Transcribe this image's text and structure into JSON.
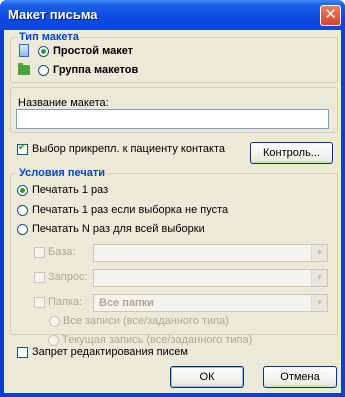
{
  "window": {
    "title": "Макет письма",
    "close_symbol": "✕"
  },
  "template_type": {
    "label": "Тип макета",
    "options": [
      {
        "label": "Простой макет",
        "selected": true
      },
      {
        "label": "Группа макетов",
        "selected": false
      }
    ]
  },
  "template_name": {
    "label": "Название макета:",
    "value": ""
  },
  "attach_contact": {
    "label": "Выбор прикрепл. к пациенту контакта",
    "checked": true
  },
  "control_button": "Контроль...",
  "print_conditions": {
    "label": "Условия печати",
    "options": [
      {
        "label": "Печатать 1 раз",
        "selected": true
      },
      {
        "label": "Печатать 1 раз если выборка не пуста",
        "selected": false
      },
      {
        "label": "Печатать N раз для всей выборки",
        "selected": false
      }
    ],
    "base": {
      "label": "База:",
      "value": ""
    },
    "query": {
      "label": "Запрос:",
      "value": ""
    },
    "folder": {
      "label": "Папка:",
      "value": "Все папки"
    },
    "records": [
      "Все записи (все/заданного типа)",
      "Текущая запись (все/заданного типа)"
    ]
  },
  "forbid_edit": {
    "label": "Запрет редактирования писем",
    "checked": false
  },
  "ok_button": "ОК",
  "cancel_button": "Отмена",
  "colors": {
    "titlebar": "#0a4ae0",
    "client": "#ece9d8",
    "group_label": "#0046d5",
    "check": "#21a121"
  }
}
